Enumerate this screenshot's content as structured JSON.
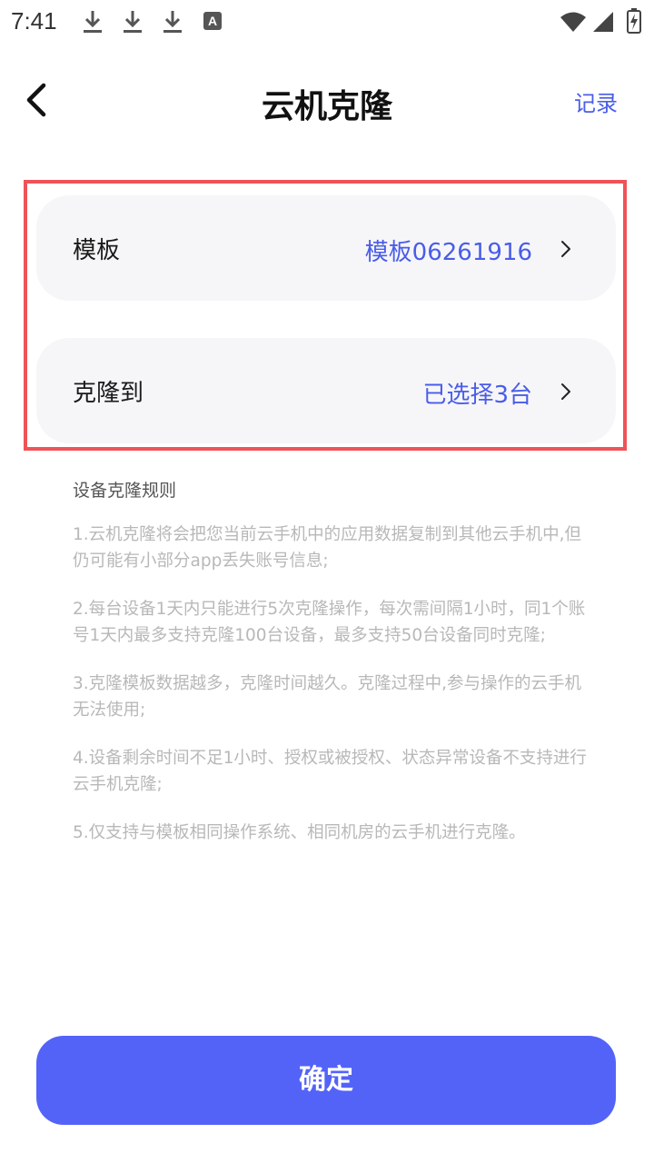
{
  "status_bar": {
    "time": "7:41",
    "icons": [
      "download-icon",
      "download-icon",
      "download-icon",
      "a-notification-icon",
      "wifi-icon",
      "signal-icon",
      "battery-charging-icon"
    ],
    "a_icon_label": "A"
  },
  "header": {
    "title": "云机克隆",
    "records_label": "记录"
  },
  "rows": {
    "template_label": "模板",
    "template_value": "模板06261916",
    "clone_to_label": "克隆到",
    "clone_to_value": "已选择3台"
  },
  "rules": {
    "title": "设备克隆规则",
    "items": [
      "1.云机克隆将会把您当前云手机中的应用数据复制到其他云手机中,但仍可能有小部分app丢失账号信息;",
      "2.每台设备1天内只能进行5次克隆操作，每次需间隔1小时，同1个账号1天内最多支持克隆100台设备，最多支持50台设备同时克隆;",
      "3.克隆模板数据越多，克隆时间越久。克隆过程中,参与操作的云手机无法使用;",
      "4.设备剩余时间不足1小时、授权或被授权、状态异常设备不支持进行云手机克隆;",
      "5.仅支持与模板相同操作系统、相同机房的云手机进行克隆。"
    ]
  },
  "confirm_label": "确定",
  "colors": {
    "accent": "#4a5de8",
    "button": "#5363f8",
    "highlight": "#ef5358",
    "card_bg": "#f6f6f8"
  }
}
